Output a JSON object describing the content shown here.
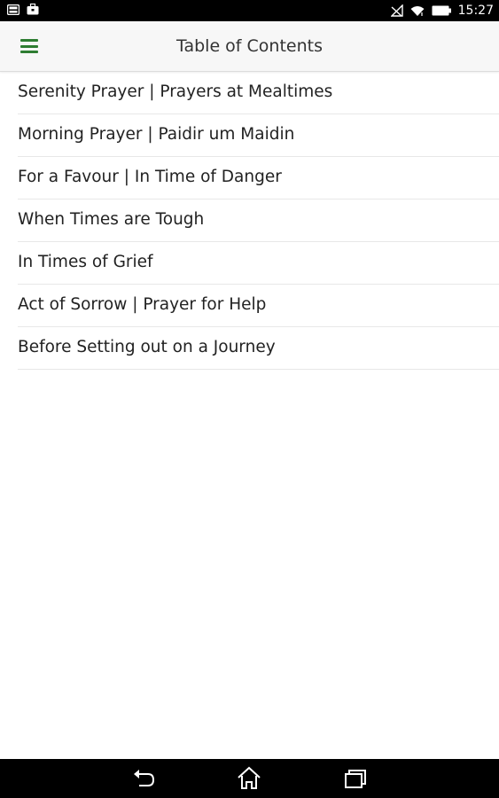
{
  "status_bar": {
    "time": "15:27",
    "icons_left": [
      "gallery-icon",
      "briefcase-icon"
    ],
    "icons_right": [
      "no-signal-icon",
      "wifi-icon",
      "battery-icon"
    ]
  },
  "app_bar": {
    "title": "Table of Contents",
    "menu_icon": "hamburger-menu-icon",
    "accent_color": "#2e7d32"
  },
  "toc": {
    "items": [
      {
        "label": "Serenity Prayer | Prayers at Mealtimes"
      },
      {
        "label": "Morning Prayer | Paidir um Maidin"
      },
      {
        "label": "For a Favour | In Time of Danger"
      },
      {
        "label": "When Times are Tough"
      },
      {
        "label": "In Times of Grief"
      },
      {
        "label": "Act of Sorrow | Prayer for Help"
      },
      {
        "label": "Before Setting out on a Journey"
      }
    ]
  },
  "nav_bar": {
    "buttons": [
      "back-icon",
      "home-icon",
      "recent-apps-icon"
    ]
  }
}
